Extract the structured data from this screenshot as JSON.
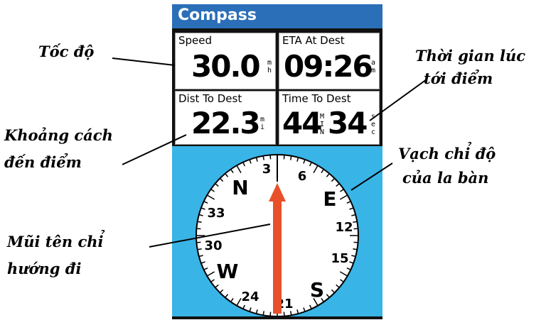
{
  "title": "Compass",
  "fields": {
    "speed": {
      "label": "Speed",
      "value": "30.0",
      "unit": "mh"
    },
    "eta": {
      "label": "ETA At Dest",
      "value": "09:26",
      "unit": "am"
    },
    "dist": {
      "label": "Dist To Dest",
      "value": "22.3",
      "unit": "mi"
    },
    "time": {
      "label": "Time To Dest",
      "value_min": "44",
      "min_unit": "MIN",
      "value_sec": "34",
      "sec_unit": "sec"
    }
  },
  "compass": {
    "cardinals": {
      "north": "N",
      "east": "E",
      "south": "S",
      "west": "W"
    },
    "numbers": [
      "3",
      "6",
      "12",
      "15",
      "21",
      "24",
      "30",
      "33"
    ],
    "arrow_color": "#e8502a",
    "background_color": "#39b4e6"
  },
  "annotations": {
    "speed": "Tốc độ",
    "arrival_time_line1": "Thời gian lúc",
    "arrival_time_line2": "tới điểm",
    "distance_line1": "Khoảng cách",
    "distance_line2": "đến điểm",
    "ticks_line1": "Vạch chỉ độ",
    "ticks_line2": "của la bàn",
    "arrow_line1": "Mũi tên chỉ",
    "arrow_line2": "hướng đi"
  }
}
